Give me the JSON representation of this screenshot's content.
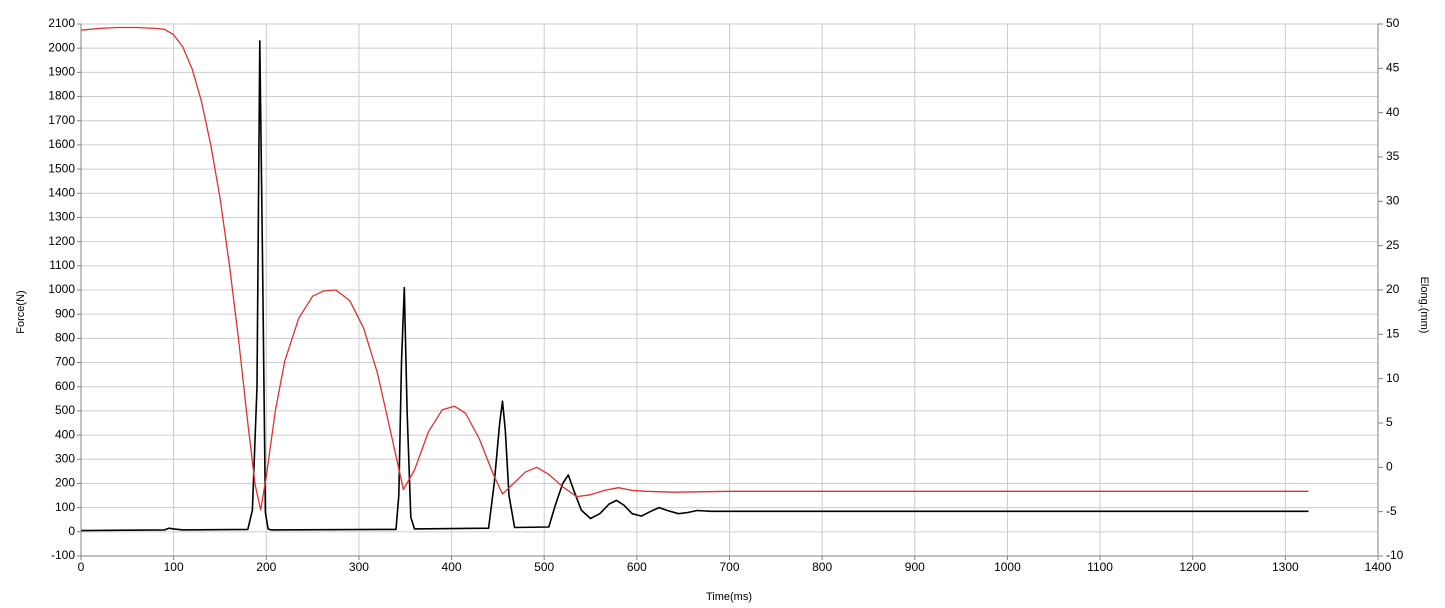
{
  "chart_data": {
    "type": "line",
    "xlabel": "Time(ms)",
    "ylabel_left": "Force(N)",
    "ylabel_right": "Elong.(mm)",
    "xlim": [
      0,
      1400
    ],
    "ylim_left": [
      -100,
      2100
    ],
    "ylim_right": [
      -10,
      50
    ],
    "x_ticks": [
      0,
      100,
      200,
      300,
      400,
      500,
      600,
      700,
      800,
      900,
      1000,
      1100,
      1200,
      1300,
      1400
    ],
    "y_ticks_left": [
      -100,
      0,
      100,
      200,
      300,
      400,
      500,
      600,
      700,
      800,
      900,
      1000,
      1100,
      1200,
      1300,
      1400,
      1500,
      1600,
      1700,
      1800,
      1900,
      2000,
      2100
    ],
    "y_ticks_right": [
      -10,
      -5,
      0,
      5,
      10,
      15,
      20,
      25,
      30,
      35,
      40,
      45,
      50
    ],
    "grid": true,
    "colors": {
      "force": "#000000",
      "elongation": "#e03030",
      "grid": "#cccccc",
      "axis": "#808080"
    },
    "series": [
      {
        "axis": "left",
        "color": "#000000",
        "x": [
          0,
          90,
          95,
          100,
          110,
          180,
          185,
          190,
          193,
          196,
          199,
          202,
          205,
          340,
          343,
          346,
          349,
          352,
          356,
          360,
          440,
          446,
          452,
          455,
          458,
          462,
          468,
          505,
          512,
          520,
          526,
          532,
          540,
          550,
          560,
          570,
          578,
          586,
          595,
          605,
          615,
          624,
          633,
          645,
          655,
          665,
          680,
          700,
          1325
        ],
        "y": [
          5,
          8,
          15,
          12,
          8,
          10,
          90,
          600,
          2030,
          1100,
          80,
          12,
          8,
          10,
          150,
          700,
          1010,
          500,
          60,
          12,
          15,
          200,
          450,
          540,
          420,
          150,
          18,
          20,
          110,
          200,
          235,
          170,
          90,
          55,
          75,
          115,
          130,
          110,
          75,
          65,
          85,
          100,
          88,
          75,
          80,
          88,
          85,
          85,
          85
        ]
      },
      {
        "axis": "right",
        "color": "#e03030",
        "x": [
          0,
          20,
          40,
          60,
          80,
          90,
          100,
          110,
          120,
          130,
          140,
          150,
          160,
          170,
          180,
          188,
          194,
          200,
          210,
          220,
          235,
          250,
          262,
          275,
          290,
          305,
          320,
          335,
          348,
          360,
          375,
          390,
          403,
          415,
          430,
          445,
          455,
          465,
          480,
          492,
          505,
          520,
          535,
          550,
          565,
          580,
          595,
          610,
          640,
          700,
          800,
          1000,
          1200,
          1325
        ],
        "y": [
          49.3,
          49.5,
          49.6,
          49.6,
          49.5,
          49.4,
          48.8,
          47.4,
          44.9,
          41.3,
          36.4,
          30.4,
          23.0,
          14.5,
          5.0,
          -2.0,
          -4.8,
          -1.0,
          6.5,
          12.0,
          16.8,
          19.3,
          19.9,
          20.0,
          18.8,
          15.7,
          10.6,
          3.6,
          -2.5,
          -0.3,
          4.0,
          6.5,
          6.9,
          6.1,
          3.2,
          -0.8,
          -3.0,
          -2.0,
          -0.5,
          0.0,
          -0.8,
          -2.2,
          -3.3,
          -3.1,
          -2.6,
          -2.3,
          -2.6,
          -2.7,
          -2.8,
          -2.7,
          -2.7,
          -2.7,
          -2.7,
          -2.7
        ]
      }
    ]
  }
}
